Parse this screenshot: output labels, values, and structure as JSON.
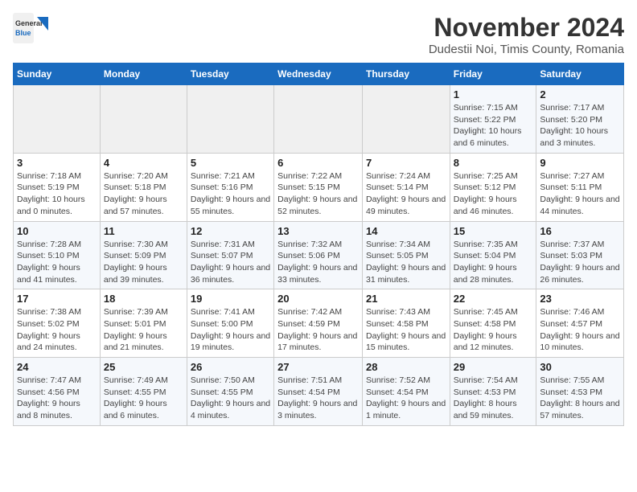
{
  "header": {
    "logo_general": "General",
    "logo_blue": "Blue",
    "title": "November 2024",
    "subtitle": "Dudestii Noi, Timis County, Romania"
  },
  "weekdays": [
    "Sunday",
    "Monday",
    "Tuesday",
    "Wednesday",
    "Thursday",
    "Friday",
    "Saturday"
  ],
  "weeks": [
    [
      {
        "day": "",
        "info": ""
      },
      {
        "day": "",
        "info": ""
      },
      {
        "day": "",
        "info": ""
      },
      {
        "day": "",
        "info": ""
      },
      {
        "day": "",
        "info": ""
      },
      {
        "day": "1",
        "info": "Sunrise: 7:15 AM\nSunset: 5:22 PM\nDaylight: 10 hours and 6 minutes."
      },
      {
        "day": "2",
        "info": "Sunrise: 7:17 AM\nSunset: 5:20 PM\nDaylight: 10 hours and 3 minutes."
      }
    ],
    [
      {
        "day": "3",
        "info": "Sunrise: 7:18 AM\nSunset: 5:19 PM\nDaylight: 10 hours and 0 minutes."
      },
      {
        "day": "4",
        "info": "Sunrise: 7:20 AM\nSunset: 5:18 PM\nDaylight: 9 hours and 57 minutes."
      },
      {
        "day": "5",
        "info": "Sunrise: 7:21 AM\nSunset: 5:16 PM\nDaylight: 9 hours and 55 minutes."
      },
      {
        "day": "6",
        "info": "Sunrise: 7:22 AM\nSunset: 5:15 PM\nDaylight: 9 hours and 52 minutes."
      },
      {
        "day": "7",
        "info": "Sunrise: 7:24 AM\nSunset: 5:14 PM\nDaylight: 9 hours and 49 minutes."
      },
      {
        "day": "8",
        "info": "Sunrise: 7:25 AM\nSunset: 5:12 PM\nDaylight: 9 hours and 46 minutes."
      },
      {
        "day": "9",
        "info": "Sunrise: 7:27 AM\nSunset: 5:11 PM\nDaylight: 9 hours and 44 minutes."
      }
    ],
    [
      {
        "day": "10",
        "info": "Sunrise: 7:28 AM\nSunset: 5:10 PM\nDaylight: 9 hours and 41 minutes."
      },
      {
        "day": "11",
        "info": "Sunrise: 7:30 AM\nSunset: 5:09 PM\nDaylight: 9 hours and 39 minutes."
      },
      {
        "day": "12",
        "info": "Sunrise: 7:31 AM\nSunset: 5:07 PM\nDaylight: 9 hours and 36 minutes."
      },
      {
        "day": "13",
        "info": "Sunrise: 7:32 AM\nSunset: 5:06 PM\nDaylight: 9 hours and 33 minutes."
      },
      {
        "day": "14",
        "info": "Sunrise: 7:34 AM\nSunset: 5:05 PM\nDaylight: 9 hours and 31 minutes."
      },
      {
        "day": "15",
        "info": "Sunrise: 7:35 AM\nSunset: 5:04 PM\nDaylight: 9 hours and 28 minutes."
      },
      {
        "day": "16",
        "info": "Sunrise: 7:37 AM\nSunset: 5:03 PM\nDaylight: 9 hours and 26 minutes."
      }
    ],
    [
      {
        "day": "17",
        "info": "Sunrise: 7:38 AM\nSunset: 5:02 PM\nDaylight: 9 hours and 24 minutes."
      },
      {
        "day": "18",
        "info": "Sunrise: 7:39 AM\nSunset: 5:01 PM\nDaylight: 9 hours and 21 minutes."
      },
      {
        "day": "19",
        "info": "Sunrise: 7:41 AM\nSunset: 5:00 PM\nDaylight: 9 hours and 19 minutes."
      },
      {
        "day": "20",
        "info": "Sunrise: 7:42 AM\nSunset: 4:59 PM\nDaylight: 9 hours and 17 minutes."
      },
      {
        "day": "21",
        "info": "Sunrise: 7:43 AM\nSunset: 4:58 PM\nDaylight: 9 hours and 15 minutes."
      },
      {
        "day": "22",
        "info": "Sunrise: 7:45 AM\nSunset: 4:58 PM\nDaylight: 9 hours and 12 minutes."
      },
      {
        "day": "23",
        "info": "Sunrise: 7:46 AM\nSunset: 4:57 PM\nDaylight: 9 hours and 10 minutes."
      }
    ],
    [
      {
        "day": "24",
        "info": "Sunrise: 7:47 AM\nSunset: 4:56 PM\nDaylight: 9 hours and 8 minutes."
      },
      {
        "day": "25",
        "info": "Sunrise: 7:49 AM\nSunset: 4:55 PM\nDaylight: 9 hours and 6 minutes."
      },
      {
        "day": "26",
        "info": "Sunrise: 7:50 AM\nSunset: 4:55 PM\nDaylight: 9 hours and 4 minutes."
      },
      {
        "day": "27",
        "info": "Sunrise: 7:51 AM\nSunset: 4:54 PM\nDaylight: 9 hours and 3 minutes."
      },
      {
        "day": "28",
        "info": "Sunrise: 7:52 AM\nSunset: 4:54 PM\nDaylight: 9 hours and 1 minute."
      },
      {
        "day": "29",
        "info": "Sunrise: 7:54 AM\nSunset: 4:53 PM\nDaylight: 8 hours and 59 minutes."
      },
      {
        "day": "30",
        "info": "Sunrise: 7:55 AM\nSunset: 4:53 PM\nDaylight: 8 hours and 57 minutes."
      }
    ]
  ]
}
